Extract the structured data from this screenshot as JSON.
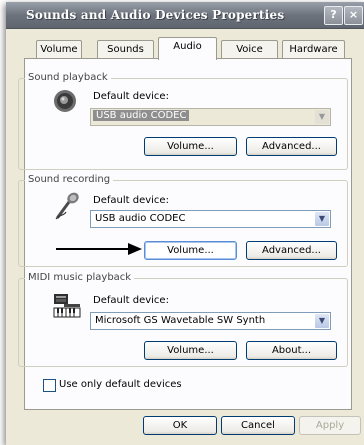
{
  "window": {
    "title": "Sounds and Audio Devices Properties",
    "help": "?",
    "close": "×"
  },
  "tabs": [
    "Volume",
    "Sounds",
    "Audio",
    "Voice",
    "Hardware"
  ],
  "playback": {
    "legend": "Sound playback",
    "device_label": "Default device:",
    "device": "USB audio CODEC",
    "volume": "Volume...",
    "advanced": "Advanced..."
  },
  "recording": {
    "legend": "Sound recording",
    "device_label": "Default device:",
    "device": "USB audio CODEC",
    "volume": "Volume...",
    "advanced": "Advanced..."
  },
  "midi": {
    "legend": "MIDI music playback",
    "device_label": "Default device:",
    "device": "Microsoft GS Wavetable SW Synth",
    "volume": "Volume...",
    "about": "About..."
  },
  "options": {
    "default_only": "Use only default devices"
  },
  "footer": {
    "ok": "OK",
    "cancel": "Cancel",
    "apply": "Apply"
  },
  "icons": [
    "speaker-icon",
    "microphone-icon",
    "midi-keyboard-icon",
    "arrow-pointer-icon",
    "chevron-down-icon"
  ]
}
